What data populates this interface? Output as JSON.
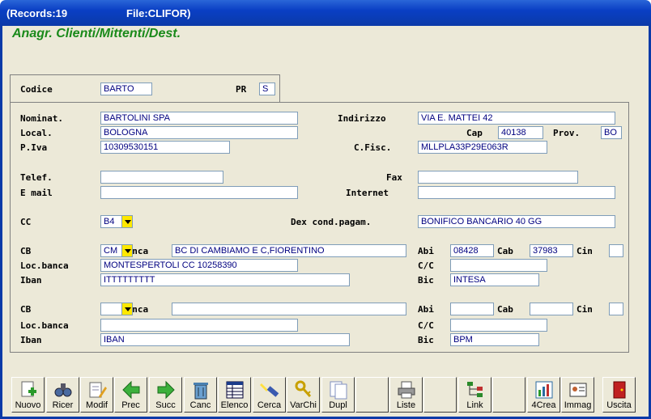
{
  "window": {
    "records": "(Records:19",
    "file": "File:CLIFOR)"
  },
  "form": {
    "title": "Anagr. Clienti/Mittenti/Dest."
  },
  "header": {
    "codice_label": "Codice",
    "codice": "BARTO",
    "pr_label": "PR",
    "pr": "S"
  },
  "main": {
    "nominat_label": "Nominat.",
    "nominat": "BARTOLINI SPA",
    "indirizzo_label": "Indirizzo",
    "indirizzo": "VIA E. MATTEI  42",
    "local_label": "Local.",
    "local": "BOLOGNA",
    "cap_label": "Cap",
    "cap": "40138",
    "prov_label": "Prov.",
    "prov": "BO",
    "piva_label": "P.Iva",
    "piva": "10309530151",
    "cfisc_label": "C.Fisc.",
    "cfisc": "MLLPLA33P29E063R",
    "telef_label": "Telef.",
    "telef": "",
    "fax_label": "Fax",
    "fax": "",
    "email_label": "E mail",
    "email": "",
    "internet_label": "Internet",
    "internet": "",
    "cc_label": "CC",
    "cc": "B4",
    "dexcond_label": "Dex cond.pagam.",
    "dexcond": "BONIFICO BANCARIO 40 GG"
  },
  "bank1": {
    "cb_label": "CB",
    "cb": "CM",
    "banca_label": "Banca",
    "banca": "BC DI CAMBIAMO E C,FIORENTINO",
    "abi_label": "Abi",
    "abi": "08428",
    "cab_label": "Cab",
    "cab": "37983",
    "cin_label": "Cin",
    "cin": "",
    "locbanca_label": "Loc.banca",
    "locbanca": "MONTESPERTOLI CC 10258390",
    "cc_label": "C/C",
    "cc": "",
    "iban_label": "Iban",
    "iban": "ITTTTTTTTT",
    "bic_label": "Bic",
    "bic": "INTESA"
  },
  "bank2": {
    "cb_label": "CB",
    "cb": "",
    "banca_label": "Banca",
    "banca": "",
    "abi_label": "Abi",
    "abi": "",
    "cab_label": "Cab",
    "cab": "",
    "cin_label": "Cin",
    "cin": "",
    "locbanca_label": "Loc.banca",
    "locbanca": "",
    "cc_label": "C/C",
    "cc": "",
    "iban_label": "Iban",
    "iban": "IBAN",
    "bic_label": "Bic",
    "bic": "BPM"
  },
  "toolbar": {
    "nuovo": "Nuovo",
    "ricer": "Ricer",
    "modif": "Modif",
    "prec": "Prec",
    "succ": "Succ",
    "canc": "Canc",
    "elenco": "Elenco",
    "cerca": "Cerca",
    "varchi": "VarChi",
    "dupl": "Dupl",
    "liste": "Liste",
    "link": "Link",
    "crea4": "4Crea",
    "immag": "Immag",
    "uscita": "Uscita"
  },
  "colors": {
    "title_green": "#1a8a1a",
    "field_text": "#000080",
    "dropdown": "#ffe800",
    "titlebar": "#0a3fc4"
  }
}
